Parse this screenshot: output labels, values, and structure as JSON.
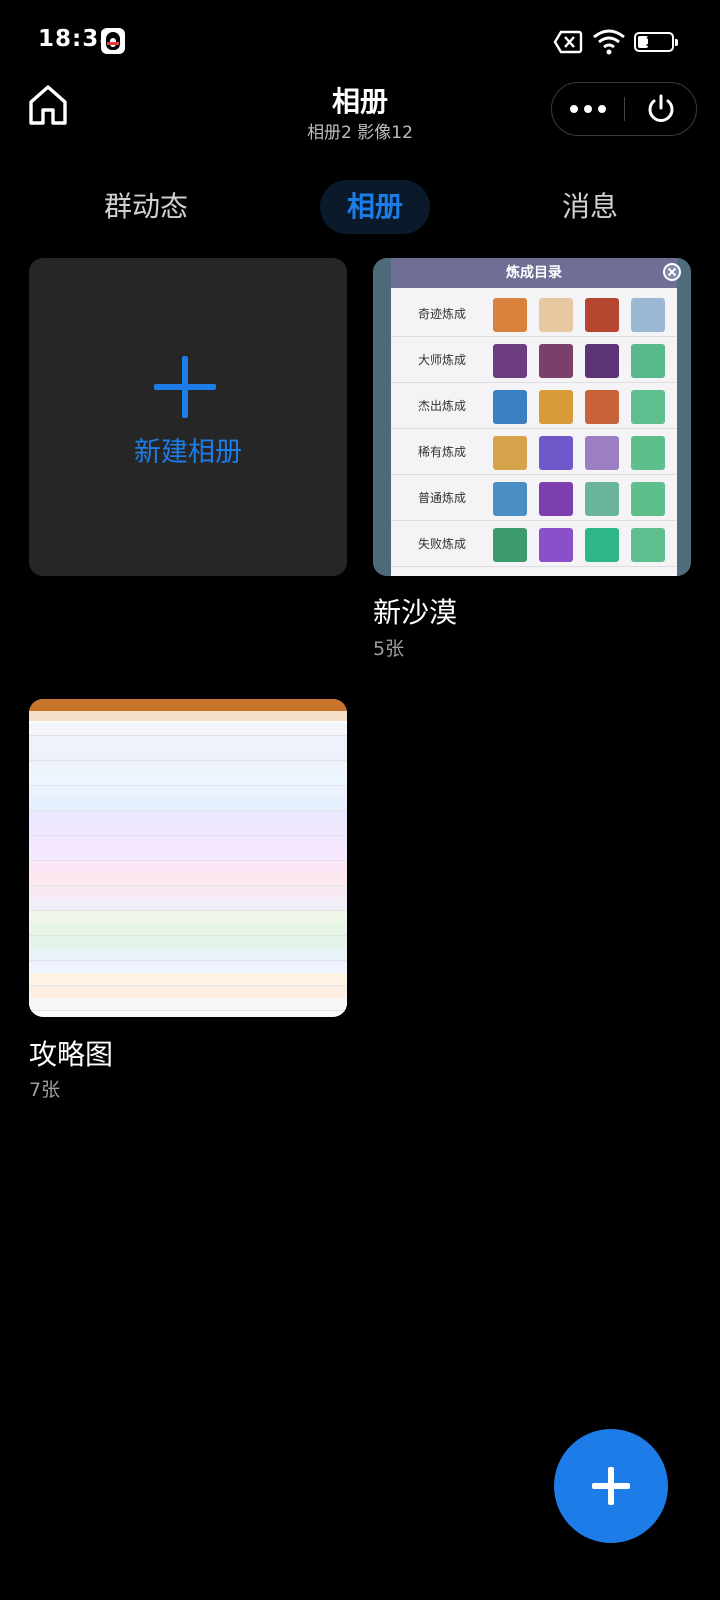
{
  "status_bar": {
    "time": "18:38",
    "battery": "31",
    "battery_level": 0.31,
    "icons": [
      "qq-icon",
      "no-sim-icon",
      "wifi-icon",
      "battery-icon"
    ]
  },
  "header": {
    "title": "相册",
    "subtitle": "相册2 影像12",
    "icons": [
      "home-icon",
      "more-dots-icon",
      "power-icon"
    ]
  },
  "tabs": [
    {
      "label": "群动态",
      "active": false
    },
    {
      "label": "相册",
      "active": true
    },
    {
      "label": "消息",
      "active": false
    }
  ],
  "new_album": {
    "label": "新建相册",
    "icon": "plus-icon"
  },
  "albums": [
    {
      "name": "新沙漠",
      "count": "5张",
      "thumbnail": {
        "title": "炼成目录",
        "rows": [
          "奇迹炼成",
          "大师炼成",
          "杰出炼成",
          "稀有炼成",
          "普通炼成",
          "失败炼成"
        ]
      }
    },
    {
      "name": "攻略图",
      "count": "7张"
    }
  ],
  "fab": {
    "icon": "plus-icon"
  },
  "colors": {
    "accent": "#1e7ce8",
    "background": "#000000",
    "card": "#262626"
  }
}
